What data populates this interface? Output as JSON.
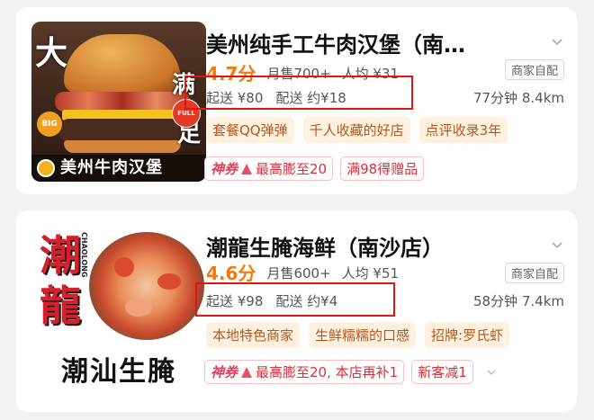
{
  "stores": [
    {
      "image": {
        "overlay_da": "大",
        "overlay_man": "满",
        "overlay_zu": "足",
        "badge_big": "BIG",
        "badge_full": "FULL",
        "brand_text": "美州牛肉汉堡"
      },
      "name": "美州纯手工牛肉汉堡（南…",
      "rating": "4.7分",
      "monthly_sales": "月售700+",
      "avg_price": "人均 ¥31",
      "delivery_tag": "商家自配",
      "min_order": "起送 ¥80",
      "delivery_fee": "配送 约¥18",
      "eta": "77分钟",
      "distance": "8.4km",
      "chips": [
        "套餐QQ弹弹",
        "千人收藏的好店",
        "点评收录3年"
      ],
      "promo_coupon_label": "神券",
      "promo_coupon_text": "最高膨至20",
      "promo_other": "满98得赠品"
    },
    {
      "image": {
        "logo_char1": "潮",
        "logo_char2": "龍",
        "logo_en": "CHAOLONG",
        "caption": "潮汕生腌"
      },
      "name": "潮龍生腌海鲜（南沙店）",
      "rating": "4.6分",
      "monthly_sales": "月售600+",
      "avg_price": "人均 ¥51",
      "delivery_tag": "商家自配",
      "min_order": "起送 ¥98",
      "delivery_fee": "配送 约¥4",
      "eta": "58分钟",
      "distance": "7.4km",
      "chips": [
        "本地特色商家",
        "生鲜糯糯的口感",
        "招牌:罗氏虾"
      ],
      "promo_coupon_label": "神券",
      "promo_coupon_text": "最高膨至20, 本店再补1",
      "promo_other": "新客减1"
    }
  ],
  "colors": {
    "rating": "#f27a0e",
    "highlight_box": "#e01515",
    "chip_text": "#b8561a",
    "chip_bg": "#fff1e0",
    "promo": "#d8303a"
  },
  "icons": {
    "expand": "chevron-down-icon",
    "coupon_arrow": "arrow-up-icon"
  }
}
